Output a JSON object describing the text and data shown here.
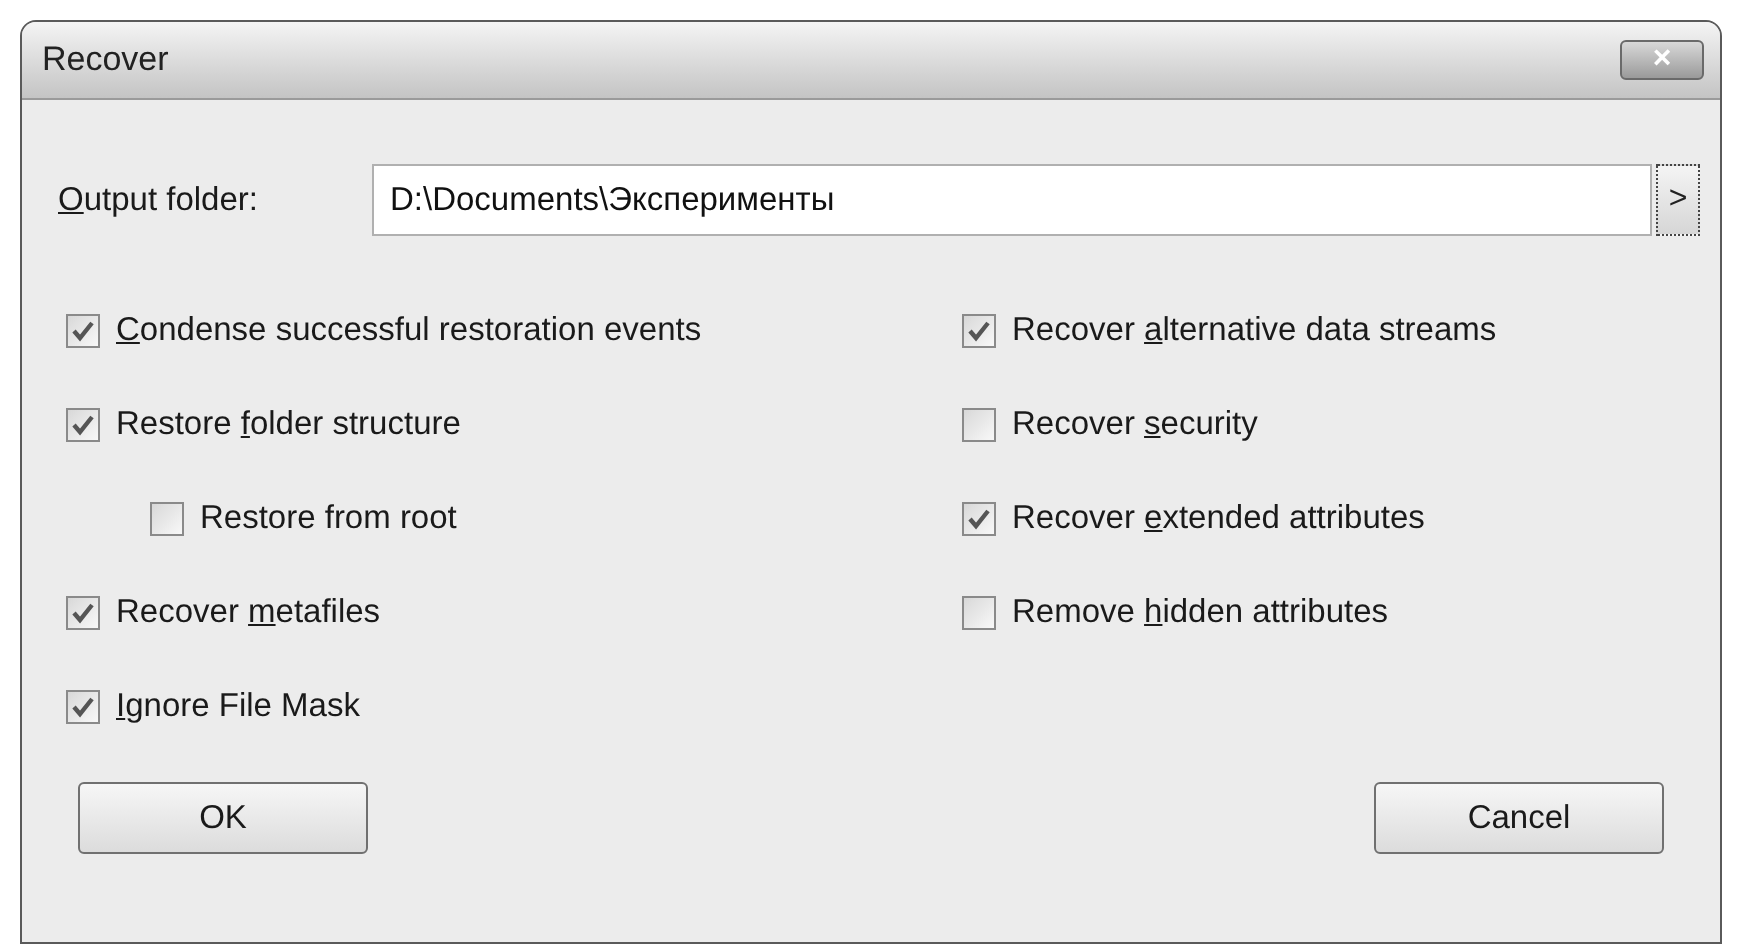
{
  "window": {
    "title": "Recover",
    "close_button": "×"
  },
  "output_folder": {
    "label": {
      "key": "O",
      "after": "utput folder:"
    },
    "value": "D:\\Documents\\Эксперименты",
    "browse_button": ">"
  },
  "left_options": [
    {
      "label": {
        "key": "C",
        "after": "ondense successful restoration events"
      },
      "checked": true
    },
    {
      "label": {
        "before": "Restore ",
        "key": "f",
        "after": "older structure"
      },
      "checked": true,
      "children": [
        {
          "label": {
            "before": "Restore from root"
          },
          "checked": false
        }
      ]
    },
    {
      "label": {
        "before": "Recover ",
        "key": "m",
        "after": "etafiles"
      },
      "checked": true
    },
    {
      "label": {
        "key": "I",
        "after": "gnore File Mask"
      },
      "checked": true
    }
  ],
  "right_options": [
    {
      "label": {
        "before": "Recover ",
        "key": "a",
        "after": "lternative data streams"
      },
      "checked": true
    },
    {
      "label": {
        "before": "Recover ",
        "key": "s",
        "after": "ecurity"
      },
      "checked": false
    },
    {
      "label": {
        "before": "Recover ",
        "key": "e",
        "after": "xtended attributes"
      },
      "checked": true
    },
    {
      "label": {
        "before": "Remove ",
        "key": "h",
        "after": "idden attributes"
      },
      "checked": false
    }
  ],
  "buttons": [
    "OK",
    "Cancel"
  ]
}
